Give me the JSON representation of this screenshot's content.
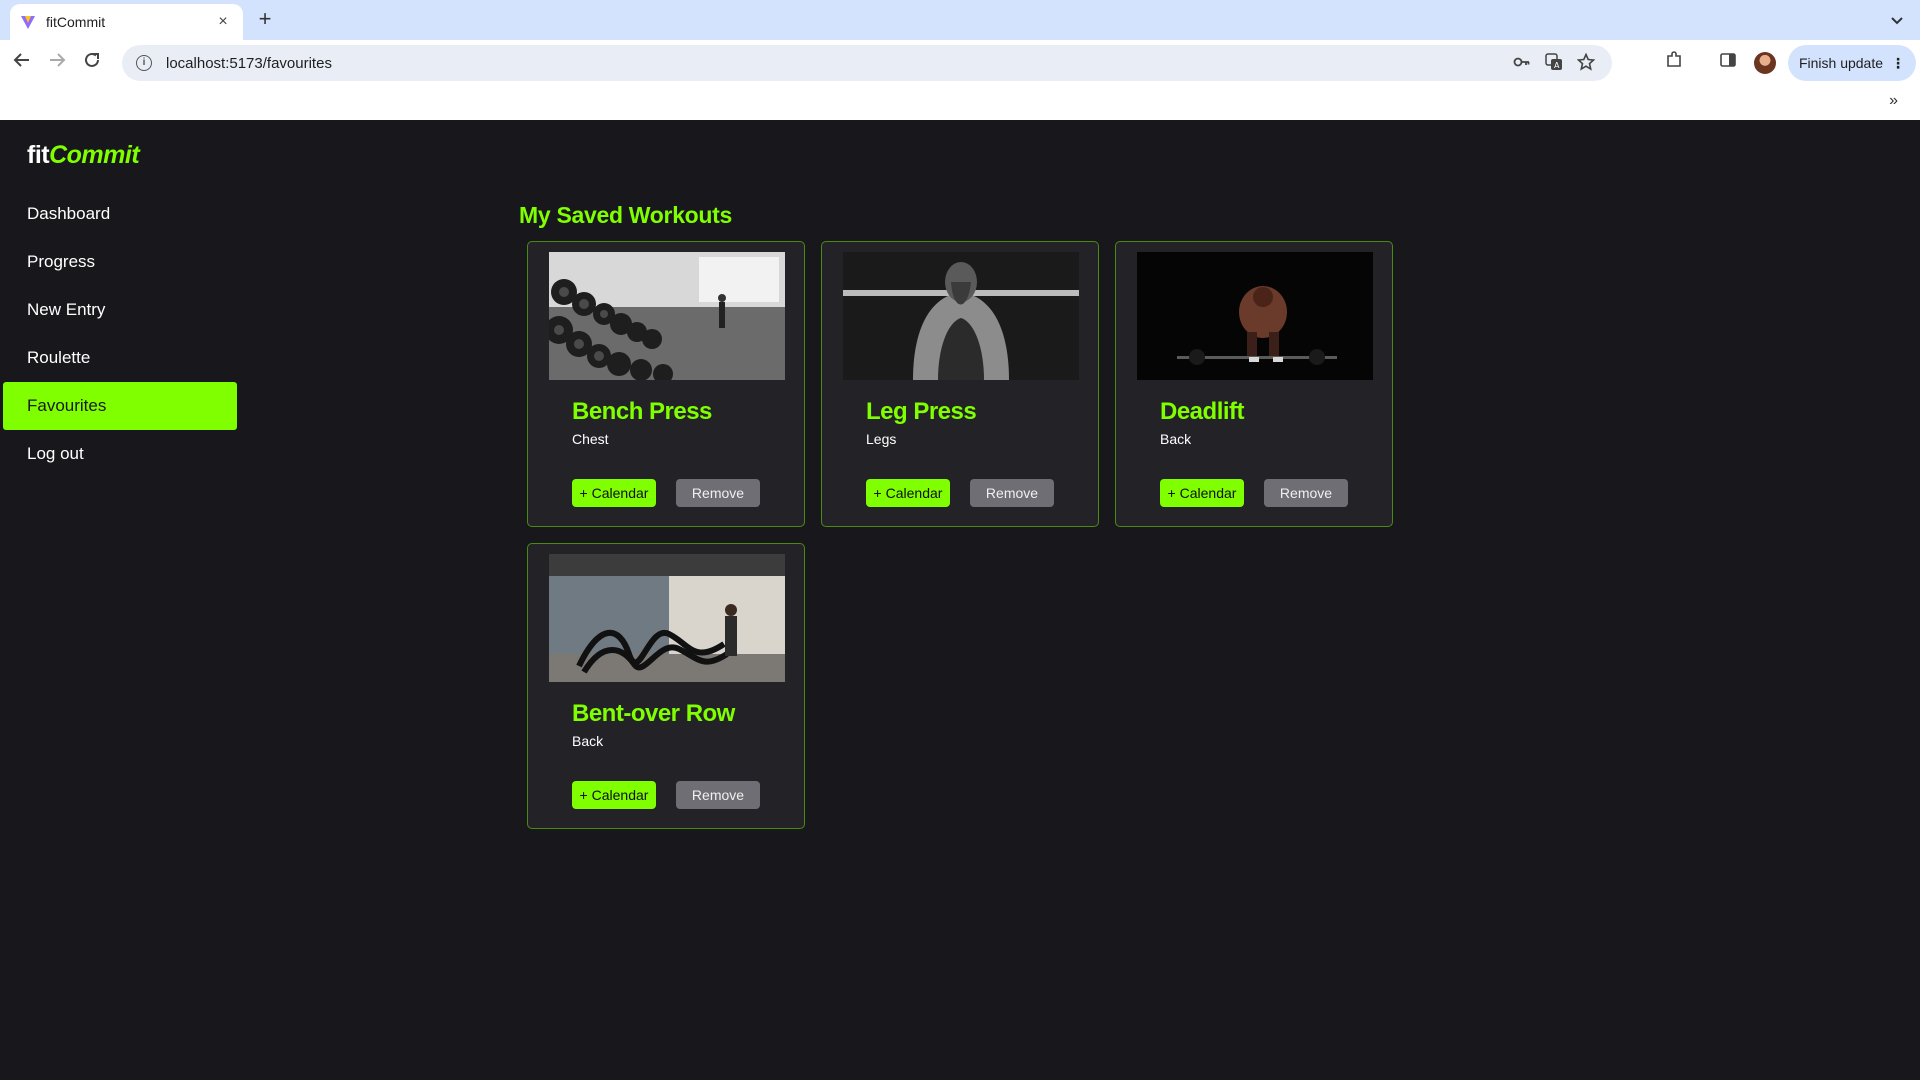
{
  "browser": {
    "tab_title": "fitCommit",
    "tab_close": "×",
    "new_tab": "+",
    "url": "localhost:5173/favourites",
    "finish_update": "Finish update",
    "finish_update_menu": "⋮",
    "bookmarks_chevron": "»"
  },
  "app": {
    "logo_fit": "fit",
    "logo_commit": "Commit",
    "accent_color": "#7fff00",
    "background_color": "#18181c"
  },
  "sidebar": {
    "items": [
      {
        "label": "Dashboard",
        "active": false
      },
      {
        "label": "Progress",
        "active": false
      },
      {
        "label": "New Entry",
        "active": false
      },
      {
        "label": "Roulette",
        "active": false
      },
      {
        "label": "Favourites",
        "active": true
      },
      {
        "label": "Log out",
        "active": false
      }
    ]
  },
  "main": {
    "title": "My Saved Workouts",
    "workouts": [
      {
        "name": "Bench Press",
        "group": "Chest",
        "calendar_label": "+ Calendar",
        "remove_label": "Remove",
        "image": "dumbbell-rack-photo"
      },
      {
        "name": "Leg Press",
        "group": "Legs",
        "calendar_label": "+ Calendar",
        "remove_label": "Remove",
        "image": "barbell-squat-photo"
      },
      {
        "name": "Deadlift",
        "group": "Back",
        "calendar_label": "+ Calendar",
        "remove_label": "Remove",
        "image": "deadlift-dark-photo"
      },
      {
        "name": "Bent-over Row",
        "group": "Back",
        "calendar_label": "+ Calendar",
        "remove_label": "Remove",
        "image": "battle-ropes-photo"
      }
    ]
  }
}
